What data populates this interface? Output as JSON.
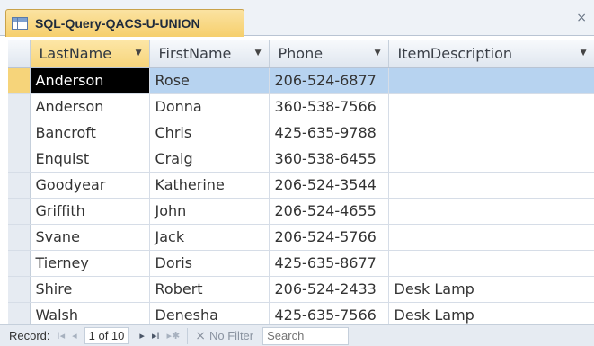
{
  "tab": {
    "title": "SQL-Query-QACS-U-UNION",
    "close_glyph": "×"
  },
  "columns": [
    "LastName",
    "FirstName",
    "Phone",
    "ItemDescription"
  ],
  "rows": [
    [
      "Anderson",
      "Rose",
      "206-524-6877",
      ""
    ],
    [
      "Anderson",
      "Donna",
      "360-538-7566",
      ""
    ],
    [
      "Bancroft",
      "Chris",
      "425-635-9788",
      ""
    ],
    [
      "Enquist",
      "Craig",
      "360-538-6455",
      ""
    ],
    [
      "Goodyear",
      "Katherine",
      "206-524-3544",
      ""
    ],
    [
      "Griffith",
      "John",
      "206-524-4655",
      ""
    ],
    [
      "Svane",
      "Jack",
      "206-524-5766",
      ""
    ],
    [
      "Tierney",
      "Doris",
      "425-635-8677",
      ""
    ],
    [
      "Shire",
      "Robert",
      "206-524-2433",
      "Desk Lamp"
    ],
    [
      "Walsh",
      "Denesha",
      "425-635-7566",
      "Desk Lamp"
    ]
  ],
  "navigation": {
    "record_label": "Record:",
    "first_glyph": "I◂",
    "prev_glyph": "◂",
    "position": "1 of 10",
    "next_glyph": "▸",
    "last_glyph": "▸I",
    "new_glyph": "▸✱",
    "filter_label": "No Filter",
    "search_placeholder": "Search"
  },
  "colors": {
    "current_row": "#b7d3f0",
    "active_tab": "#f6cf6c"
  }
}
